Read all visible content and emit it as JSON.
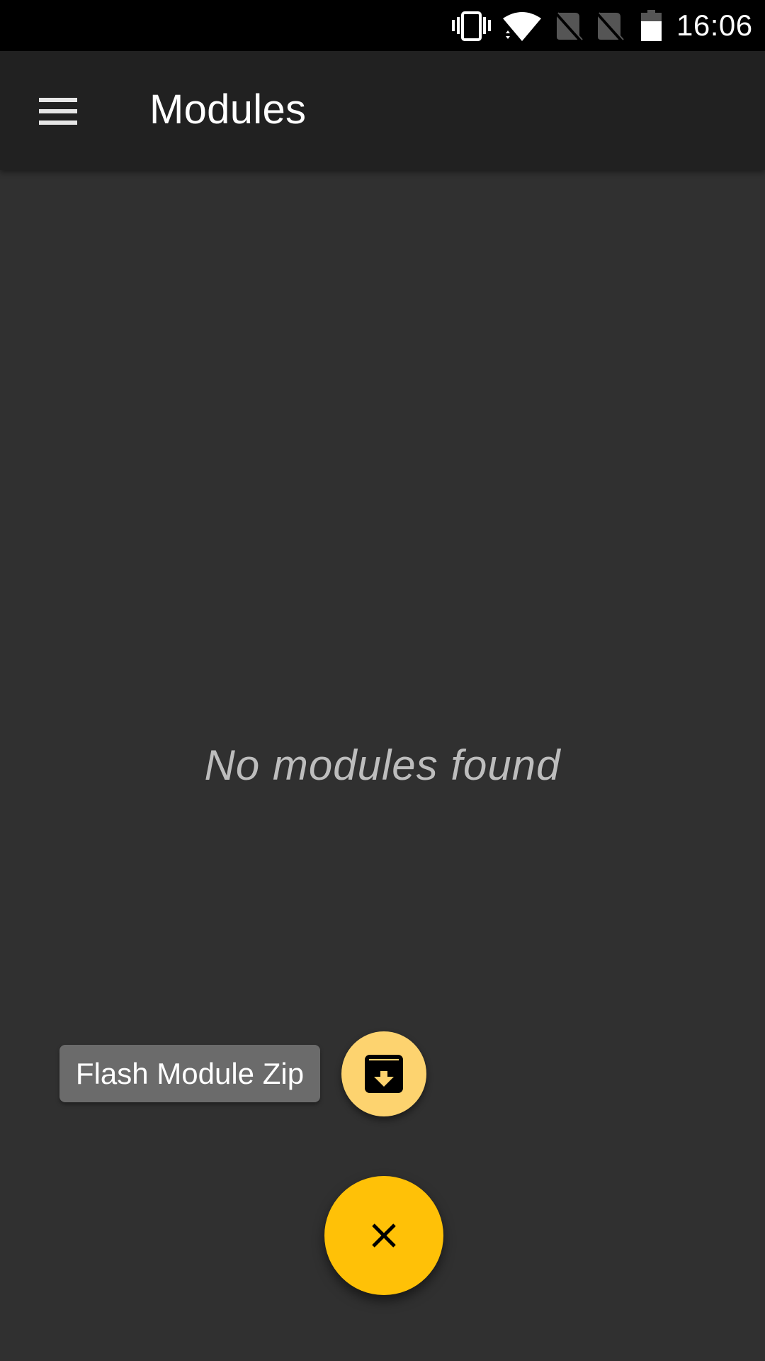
{
  "status_bar": {
    "time": "16:06",
    "icons": [
      "vibrate-icon",
      "wifi-icon",
      "no-sim-icon",
      "no-sim-icon",
      "battery-icon"
    ],
    "battery_level_percent": 70
  },
  "toolbar": {
    "menu_icon": "hamburger-menu-icon",
    "title": "Modules"
  },
  "main": {
    "empty_message": "No modules found"
  },
  "fab_menu": {
    "actions": [
      {
        "label": "Flash Module Zip",
        "icon": "archive-download-icon"
      }
    ],
    "main_fab_icon": "close-icon"
  },
  "colors": {
    "accent": "#ffc107",
    "mini_fab": "#fdd36f",
    "toolbar": "#212121",
    "background": "#303030",
    "chip": "#6b6b6b"
  }
}
